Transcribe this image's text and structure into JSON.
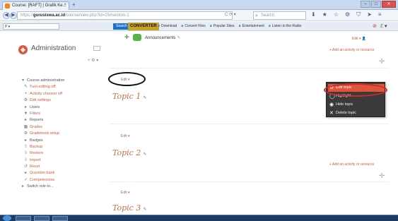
{
  "browser": {
    "tab_title": "Course: [RAFT] | Grafik Ke...",
    "tab_close": "×",
    "new_tab": "+",
    "url_prefix": "https://",
    "url_domain": "gurusiswa.ac.id",
    "url_rest": "/course/view.php?id=25#section-1",
    "url_tools": "C  ⟳  ▾",
    "search_placeholder": "Search",
    "window_min": "–",
    "window_max": "□",
    "window_close": "✕"
  },
  "toolbar": {
    "search_field": "P ▾",
    "search_button": "Search",
    "brand": "CONVERTER",
    "links": [
      "Download",
      "Convert Files",
      "Popular Sites",
      "Entertainment",
      "Listen to the Radio"
    ],
    "right_badge": "⊘",
    "right_menu": "ℰ ▾"
  },
  "admin": {
    "title": "Administration",
    "controls": "+ ⚙ ▾",
    "items": [
      {
        "label": "Course administration",
        "icon": "▾",
        "style": "dark"
      },
      {
        "label": "Turn editing off",
        "icon": "✎",
        "style": "link"
      },
      {
        "label": "Activity chooser off",
        "icon": "•",
        "style": "link"
      },
      {
        "label": "Edit settings",
        "icon": "⚙",
        "style": "link"
      },
      {
        "label": "Users",
        "icon": "▸",
        "style": "dark"
      },
      {
        "label": "Filters",
        "icon": "▼",
        "style": "link"
      },
      {
        "label": "Reports",
        "icon": "▸",
        "style": "dark"
      },
      {
        "label": "Grades",
        "icon": "▦",
        "style": "link"
      },
      {
        "label": "Gradebook setup",
        "icon": "⚙",
        "style": "link"
      },
      {
        "label": "Badges",
        "icon": "▸",
        "style": "dark"
      },
      {
        "label": "Backup",
        "icon": "⇧",
        "style": "link"
      },
      {
        "label": "Restore",
        "icon": "⇩",
        "style": "link"
      },
      {
        "label": "Import",
        "icon": "⇩",
        "style": "link"
      },
      {
        "label": "Reset",
        "icon": "↺",
        "style": "link"
      },
      {
        "label": "Question bank",
        "icon": "▸",
        "style": "link"
      },
      {
        "label": "Competencies",
        "icon": "✓",
        "style": "link"
      },
      {
        "label": "Switch role to...",
        "icon": "▸",
        "style": "dark"
      }
    ]
  },
  "course": {
    "announcements": "Announcements",
    "edit_top": "Edit ▾  👤",
    "add_activity": "+ Add an activity or resource",
    "edit": "Edit ▾",
    "topics": [
      "Topic 1",
      "Topic 2",
      "Topic 3"
    ],
    "pencil": "✎",
    "plus": "✛"
  },
  "context_menu": {
    "items": [
      {
        "label": "Edit topic",
        "icon": "⚙"
      },
      {
        "label": "Highlight",
        "icon": "◯"
      },
      {
        "label": "Hide topic",
        "icon": "◉"
      },
      {
        "label": "Delete topic",
        "icon": "✕"
      }
    ]
  }
}
